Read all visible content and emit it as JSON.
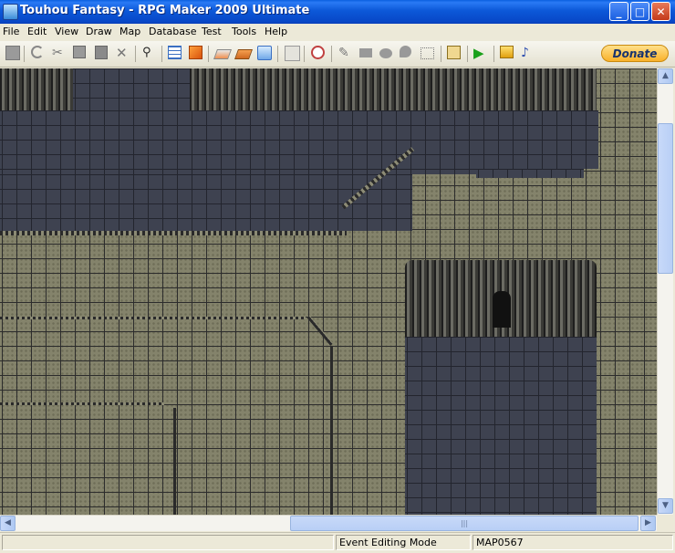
{
  "window": {
    "title": "Touhou Fantasy - RPG Maker 2009 Ultimate",
    "minimize_glyph": "_",
    "maximize_glyph": "□",
    "close_glyph": "✕"
  },
  "menu": [
    "File",
    "Edit",
    "View",
    "Draw",
    "Map",
    "Database",
    "Test",
    "Tools",
    "Help"
  ],
  "toolbar": {
    "icons": [
      "new-project-icon",
      "undo-icon",
      "cut-icon",
      "copy-icon",
      "paste-icon",
      "delete-icon",
      "find-icon",
      "database-icon",
      "material-icon",
      "lower-layer-icon",
      "upper-layer-icon",
      "event-layer-icon",
      "map-zoom-icon",
      "sound-test-icon",
      "pencil-icon",
      "rectangle-icon",
      "ellipse-icon",
      "fill-icon",
      "select-icon",
      "script-icon",
      "play-test-icon",
      "resource-manager-icon",
      "music-icon"
    ],
    "donate_label": "Donate"
  },
  "scrollbar": {
    "up": "▲",
    "down": "▼",
    "left": "◀",
    "right": "▶",
    "grip": "|||"
  },
  "status": {
    "blank": "",
    "mode": "Event Editing Mode",
    "map_id": "MAP0567"
  },
  "colors": {
    "titlebar": "#0a5fe0",
    "floor": "#84836b",
    "dark_floor": "#3e4250"
  }
}
